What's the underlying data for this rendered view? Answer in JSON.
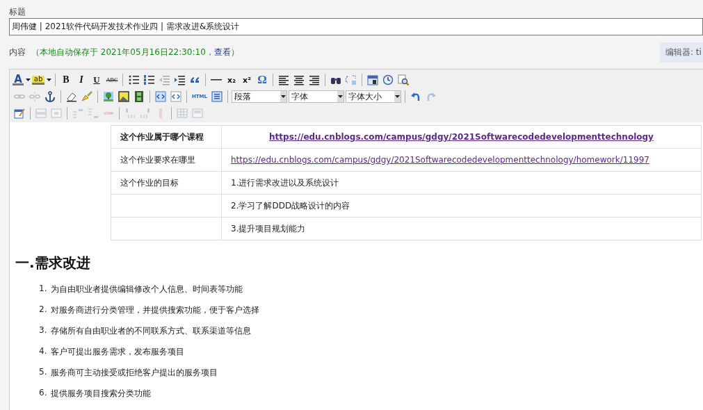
{
  "title_field": {
    "label": "标题",
    "value": "周伟健 | 2021软件代码开发技术作业四 | 需求改进&系统设计"
  },
  "content_bar": {
    "label": "内容",
    "autosave": "（本地自动保存于 2021年05月16日22:30:10，",
    "view_link": "查看",
    "autosave_end": "）",
    "editor_switch": "编辑器: ti"
  },
  "toolbar": [
    [
      {
        "kind": "text",
        "label": "A",
        "disabled": false
      },
      {
        "kind": "caret",
        "disabled": false
      },
      {
        "kind": "text",
        "label": "ab",
        "disabled": false
      },
      {
        "kind": "caret",
        "disabled": false
      },
      {
        "kind": "sep"
      },
      {
        "kind": "text",
        "label": "B",
        "disabled": false
      },
      {
        "kind": "text",
        "label": "I",
        "disabled": false
      },
      {
        "kind": "text",
        "label": "U",
        "disabled": false
      },
      {
        "kind": "text",
        "label": "ABC",
        "disabled": false
      },
      {
        "kind": "sep"
      },
      {
        "kind": "icon",
        "disabled": false
      },
      {
        "kind": "icon",
        "disabled": false
      },
      {
        "kind": "icon",
        "disabled": true
      },
      {
        "kind": "icon",
        "disabled": false
      },
      {
        "kind": "icon",
        "disabled": false
      },
      {
        "kind": "sep"
      },
      {
        "kind": "icon",
        "disabled": false
      },
      {
        "kind": "text",
        "label": "x₂",
        "disabled": false
      },
      {
        "kind": "text",
        "label": "x²",
        "disabled": false
      },
      {
        "kind": "text",
        "label": "Ω",
        "disabled": false
      },
      {
        "kind": "sep"
      },
      {
        "kind": "icon",
        "disabled": false
      },
      {
        "kind": "icon",
        "disabled": false
      },
      {
        "kind": "icon",
        "disabled": false
      },
      {
        "kind": "sep"
      },
      {
        "kind": "icon",
        "disabled": false
      },
      {
        "kind": "icon",
        "disabled": false
      },
      {
        "kind": "sep"
      },
      {
        "kind": "icon",
        "disabled": false
      },
      {
        "kind": "icon",
        "disabled": false
      },
      {
        "kind": "icon",
        "disabled": false
      }
    ],
    [
      {
        "kind": "icon",
        "disabled": true
      },
      {
        "kind": "icon",
        "disabled": true
      },
      {
        "kind": "icon",
        "disabled": false
      },
      {
        "kind": "sep"
      },
      {
        "kind": "icon",
        "disabled": false
      },
      {
        "kind": "icon",
        "disabled": false
      },
      {
        "kind": "sep"
      },
      {
        "kind": "icon",
        "disabled": false
      },
      {
        "kind": "icon",
        "disabled": false
      },
      {
        "kind": "icon",
        "disabled": false
      },
      {
        "kind": "sep"
      },
      {
        "kind": "icon",
        "disabled": false
      },
      {
        "kind": "icon",
        "disabled": false
      },
      {
        "kind": "sep"
      },
      {
        "kind": "text",
        "label": "HTML",
        "disabled": false
      },
      {
        "kind": "icon",
        "disabled": false
      },
      {
        "kind": "sep"
      },
      {
        "kind": "select",
        "value": "段落"
      },
      {
        "kind": "select",
        "value": "字体"
      },
      {
        "kind": "select",
        "value": "字体大小"
      },
      {
        "kind": "sep"
      },
      {
        "kind": "icon",
        "disabled": false
      },
      {
        "kind": "icon",
        "disabled": true
      }
    ],
    [
      {
        "kind": "icon",
        "disabled": false
      },
      {
        "kind": "sep"
      },
      {
        "kind": "icon",
        "disabled": true
      },
      {
        "kind": "icon",
        "disabled": true
      },
      {
        "kind": "sep"
      },
      {
        "kind": "icon",
        "disabled": true
      },
      {
        "kind": "icon",
        "disabled": true
      },
      {
        "kind": "icon",
        "disabled": true
      },
      {
        "kind": "sep"
      },
      {
        "kind": "icon",
        "disabled": true
      },
      {
        "kind": "icon",
        "disabled": true
      },
      {
        "kind": "icon",
        "disabled": true
      },
      {
        "kind": "sep"
      },
      {
        "kind": "icon",
        "disabled": true
      },
      {
        "kind": "icon",
        "disabled": true
      }
    ]
  ],
  "info_table": {
    "rows": [
      {
        "label": "这个作业属于哪个课程",
        "value": "https://edu.cnblogs.com/campus/gdgy/2021Softwarecodedevelopmenttechnology",
        "kind": "header"
      },
      {
        "label": "这个作业要求在哪里",
        "value": "https://edu.cnblogs.com/campus/gdgy/2021Softwarecodedevelopmenttechnology/homework/11997",
        "kind": "link"
      },
      {
        "label": "这个作业的目标",
        "value": "1.进行需求改进以及系统设计",
        "kind": "text"
      },
      {
        "value": "2.学习了解DDD战略设计的内容",
        "kind": "text"
      },
      {
        "value": "3.提升项目规划能力",
        "kind": "text"
      }
    ]
  },
  "heading": "一.需求改进",
  "requirements": [
    {
      "number": "1.",
      "text": "为自由职业者提供编辑修改个人信息、时间表等功能"
    },
    {
      "number": "2.",
      "text": "对服务商进行分类管理，并提供搜索功能，便于客户选择"
    },
    {
      "number": "3.",
      "text": "存储所有自由职业者的不同联系方式、联系渠道等信息"
    },
    {
      "number": "4.",
      "text": "客户可提出服务需求，发布服务项目"
    },
    {
      "number": "5.",
      "text": "服务商可主动接受或拒绝客户提出的服务项目"
    },
    {
      "number": "6.",
      "text": "提供服务项目搜索分类功能"
    }
  ]
}
